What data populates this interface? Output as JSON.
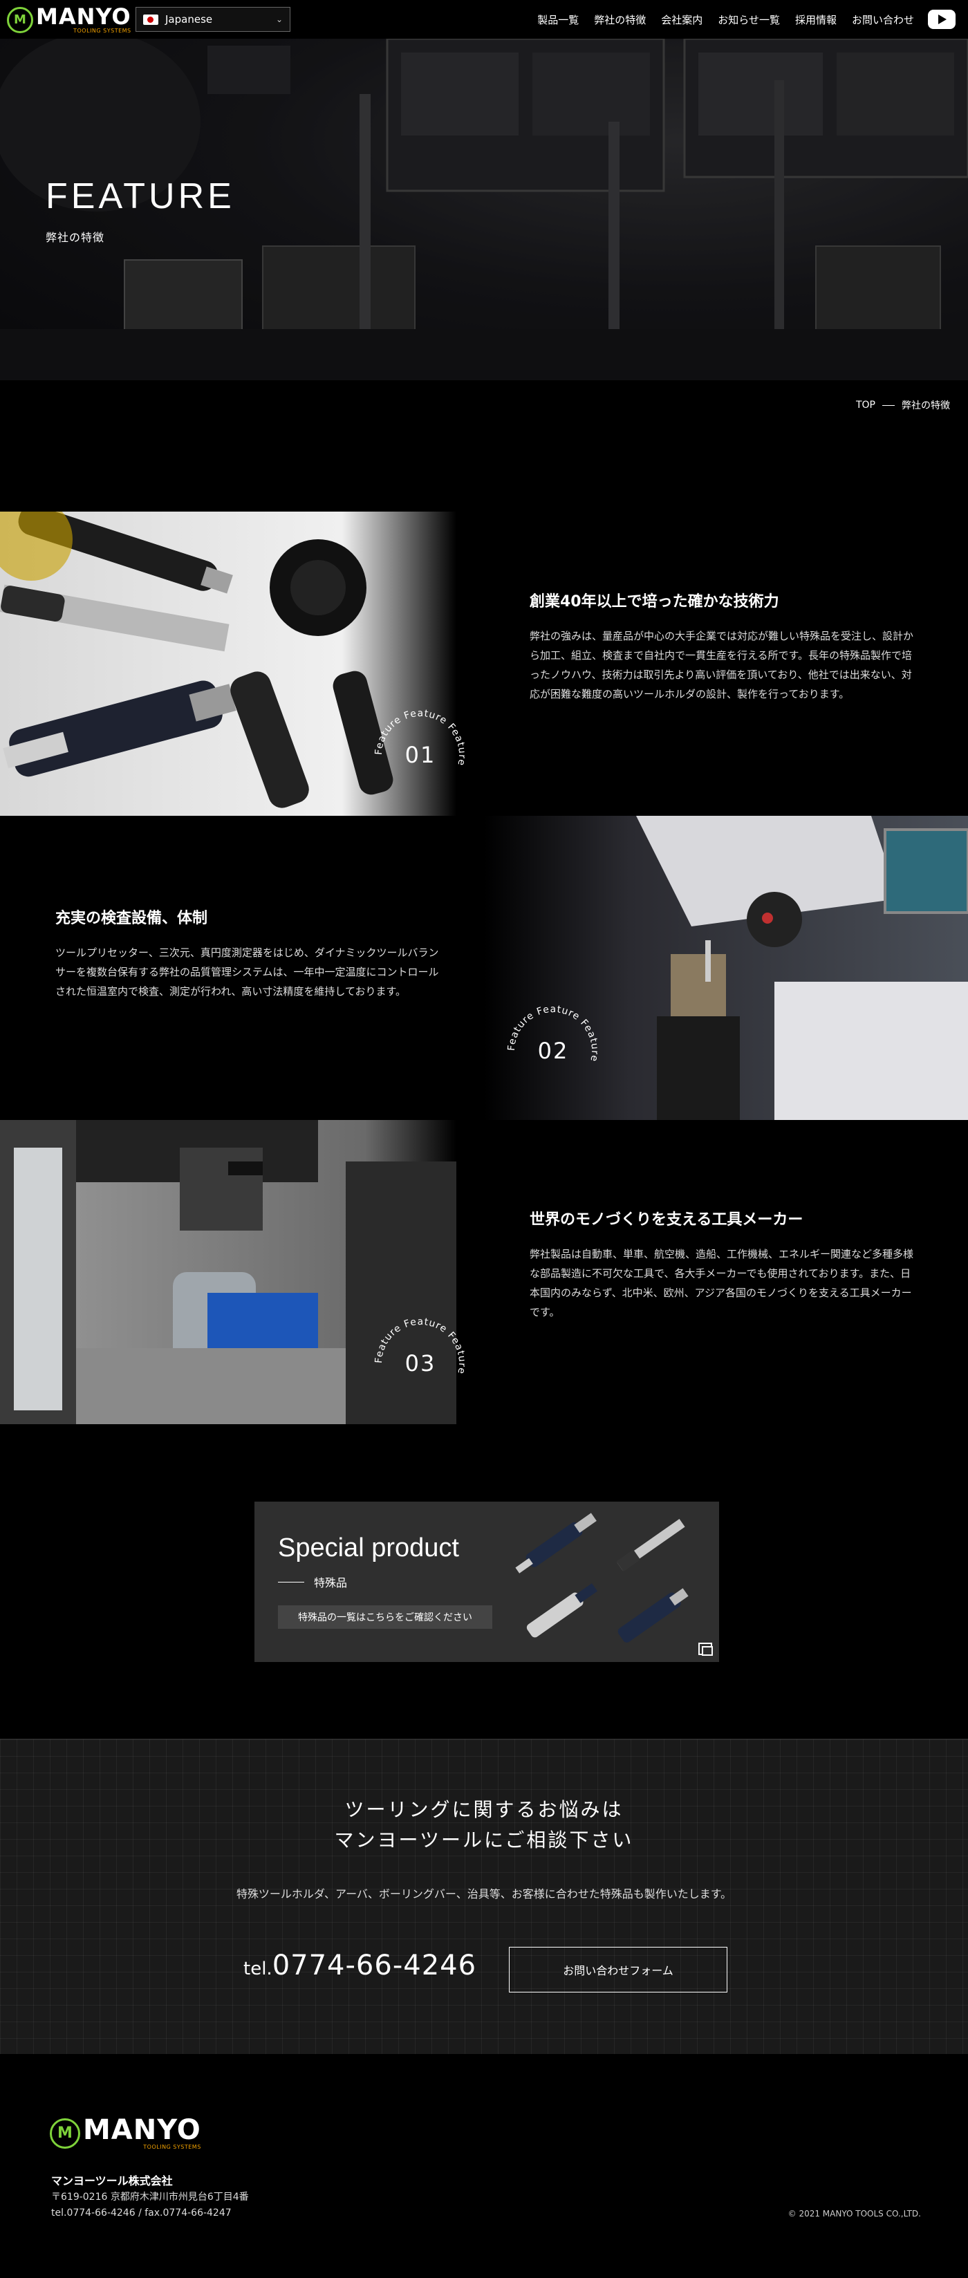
{
  "header": {
    "logo_text": "MANYO",
    "logo_sub": "TOOLING SYSTEMS",
    "language": "Japanese",
    "nav": [
      "製品一覧",
      "弊社の特徴",
      "会社案内",
      "お知らせ一覧",
      "採用情報",
      "お問い合わせ"
    ]
  },
  "hero": {
    "title": "FEATURE",
    "subtitle": "弊社の特徴"
  },
  "breadcrumb": {
    "home": "TOP",
    "current": "弊社の特徴"
  },
  "features": [
    {
      "title": "創業40年以上で培った確かな技術力",
      "body": "弊社の強みは、量産品が中心の大手企業では対応が難しい特殊品を受注し、設計から加工、組立、検査まで自社内で一貫生産を行える所です。長年の特殊品製作で培ったノウハウ、技術力は取引先より高い評価を頂いており、他社では出来ない、対応が困難な難度の高いツールホルダの設計、製作を行っております。",
      "number": "01",
      "badge_text": "Feature Feature Feature"
    },
    {
      "title": "充実の検査設備、体制",
      "body": "ツールプリセッター、三次元、真円度測定器をはじめ、ダイナミックツールバランサーを複数台保有する弊社の品質管理システムは、一年中一定温度にコントロールされた恒温室内で検査、測定が行われ、高い寸法精度を維持しております。",
      "number": "02",
      "badge_text": "Feature Feature Feature"
    },
    {
      "title": "世界のモノづくりを支える工具メーカー",
      "body": "弊社製品は自動車、単車、航空機、造船、工作機械、エネルギー関連など多種多様な部品製造に不可欠な工具で、各大手メーカーでも使用されております。また、日本国内のみならず、北中米、欧州、アジア各国のモノづくりを支える工具メーカーです。",
      "number": "03",
      "badge_text": "Feature Feature Feature"
    }
  ],
  "special": {
    "title": "Special product",
    "subtitle": "特殊品",
    "button": "特殊品の一覧はこちらをご確認ください"
  },
  "contact": {
    "title_line1": "ツーリングに関するお悩みは",
    "title_line2": "マンヨーツールにご相談下さい",
    "text": "特殊ツールホルダ、アーバ、ボーリングバー、治具等、お客様に合わせた特殊品も製作いたします。",
    "tel_prefix": "tel.",
    "tel": "0774-66-4246",
    "form_button": "お問い合わせフォーム"
  },
  "footer": {
    "company": "マンヨーツール株式会社",
    "address": "〒619-0216 京都府木津川市州見台6丁目4番",
    "tel_fax": "tel.0774-66-4246 / fax.0774-66-4247",
    "copyright": "© 2021 MANYO TOOLS CO.,LTD."
  }
}
